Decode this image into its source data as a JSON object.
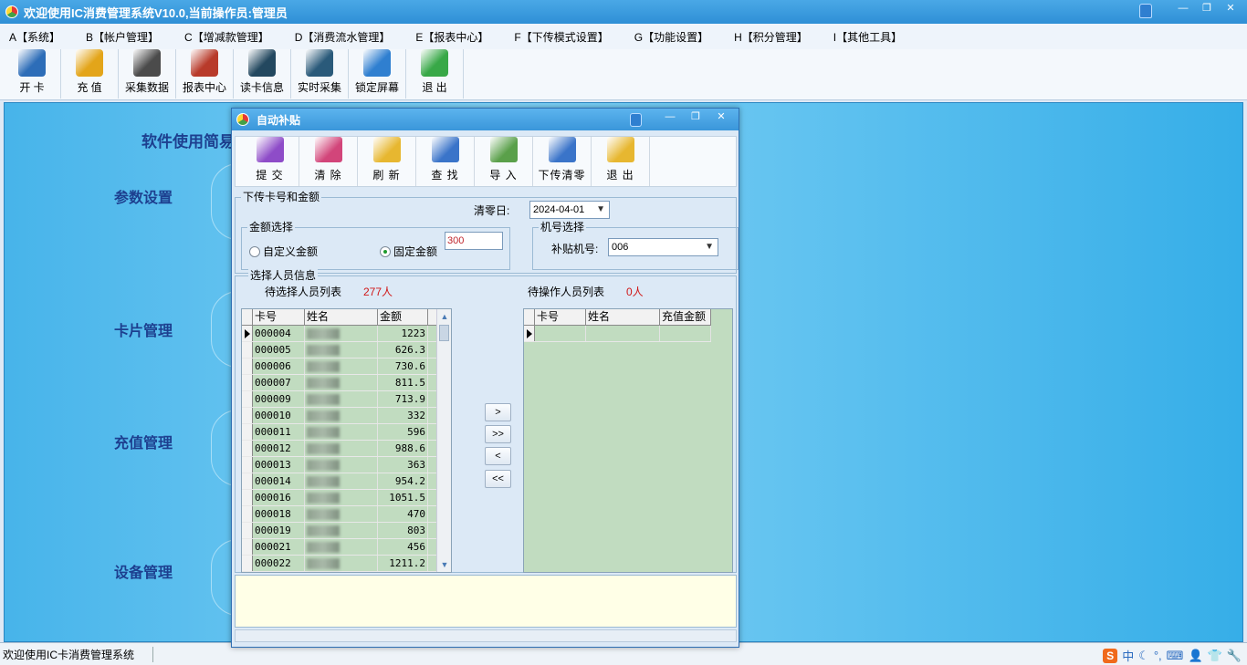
{
  "app": {
    "title": "欢迎使用IC消费管理系统V10.0,当前操作员:管理员"
  },
  "window_controls": [
    "—",
    "❐",
    "✕"
  ],
  "menu": [
    "A【系统】",
    "B【帐户管理】",
    "C【增减款管理】",
    "D【消费流水管理】",
    "E【报表中心】",
    "F【下传模式设置】",
    "G【功能设置】",
    "H【积分管理】",
    "I【其他工具】"
  ],
  "toolbar": [
    {
      "label": "开 卡",
      "icon": "card-user-icon",
      "color": "#2d6db8"
    },
    {
      "label": "充 值",
      "icon": "coins-icon",
      "color": "#e3a51a"
    },
    {
      "label": "采集数据",
      "icon": "disk-collect-icon",
      "color": "#4b4b4b"
    },
    {
      "label": "报表中心",
      "icon": "books-icon",
      "color": "#b83a2a"
    },
    {
      "label": "读卡信息",
      "icon": "monitor-icon",
      "color": "#23485f"
    },
    {
      "label": "实时采集",
      "icon": "screen-play-icon",
      "color": "#2a5a7a"
    },
    {
      "label": "锁定屏幕",
      "icon": "user-lock-icon",
      "color": "#2f7fd0"
    },
    {
      "label": "退 出",
      "icon": "exit-globe-icon",
      "color": "#38a847"
    }
  ],
  "main": {
    "guide_title": "软件使用简易",
    "sections": [
      "参数设置",
      "卡片管理",
      "充值管理",
      "设备管理"
    ]
  },
  "status": {
    "text": "欢迎使用IC卡消费管理系统"
  },
  "tray": [
    "S",
    "中",
    "☾",
    "°,",
    "⌨",
    "👤",
    "👕",
    "🔧"
  ],
  "dialog": {
    "title": "自动补贴",
    "toolbar": [
      {
        "label": "提 交",
        "icon": "submit-icon",
        "color": "#8e4cc8"
      },
      {
        "label": "清 除",
        "icon": "clear-icon",
        "color": "#d2457a"
      },
      {
        "label": "刷 新",
        "icon": "refresh-icon",
        "color": "#e7b730"
      },
      {
        "label": "查 找",
        "icon": "html-search-icon",
        "color": "#3a74c9"
      },
      {
        "label": "导 入",
        "icon": "import-icon",
        "color": "#5aa04a"
      },
      {
        "label": "下传清零",
        "icon": "html-download-icon",
        "color": "#3a74c9"
      },
      {
        "label": "退 出",
        "icon": "exit-icon",
        "color": "#e7b730"
      }
    ],
    "card_group_title": "下传卡号和金额",
    "clear_date_label": "清零日:",
    "clear_date_value": "2024-04-01",
    "amount_group_title": "金额选择",
    "custom_amount_label": "自定义金额",
    "fixed_amount_label": "固定金额",
    "fixed_amount_selected": true,
    "fixed_amount_value": "300",
    "machine_group_title": "机号选择",
    "machine_label": "补贴机号:",
    "machine_value": "006",
    "people_group_title": "选择人员信息",
    "pending_list_label": "待选择人员列表",
    "pending_count": "277人",
    "operate_list_label": "待操作人员列表",
    "operate_count": "0人",
    "left_columns": [
      "卡号",
      "姓名",
      "金额"
    ],
    "right_columns": [
      "卡号",
      "姓名",
      "充值金额"
    ],
    "rows": [
      {
        "card": "000004",
        "amount": "1223"
      },
      {
        "card": "000005",
        "amount": "626.3"
      },
      {
        "card": "000006",
        "amount": "730.6"
      },
      {
        "card": "000007",
        "amount": "811.5"
      },
      {
        "card": "000009",
        "amount": "713.9"
      },
      {
        "card": "000010",
        "amount": "332"
      },
      {
        "card": "000011",
        "amount": "596"
      },
      {
        "card": "000012",
        "amount": "988.6"
      },
      {
        "card": "000013",
        "amount": "363"
      },
      {
        "card": "000014",
        "amount": "954.2"
      },
      {
        "card": "000016",
        "amount": "1051.5"
      },
      {
        "card": "000018",
        "amount": "470"
      },
      {
        "card": "000019",
        "amount": "803"
      },
      {
        "card": "000021",
        "amount": "456"
      },
      {
        "card": "000022",
        "amount": "1211.2"
      }
    ],
    "move_buttons": [
      ">",
      ">>",
      "<",
      "<<"
    ]
  }
}
